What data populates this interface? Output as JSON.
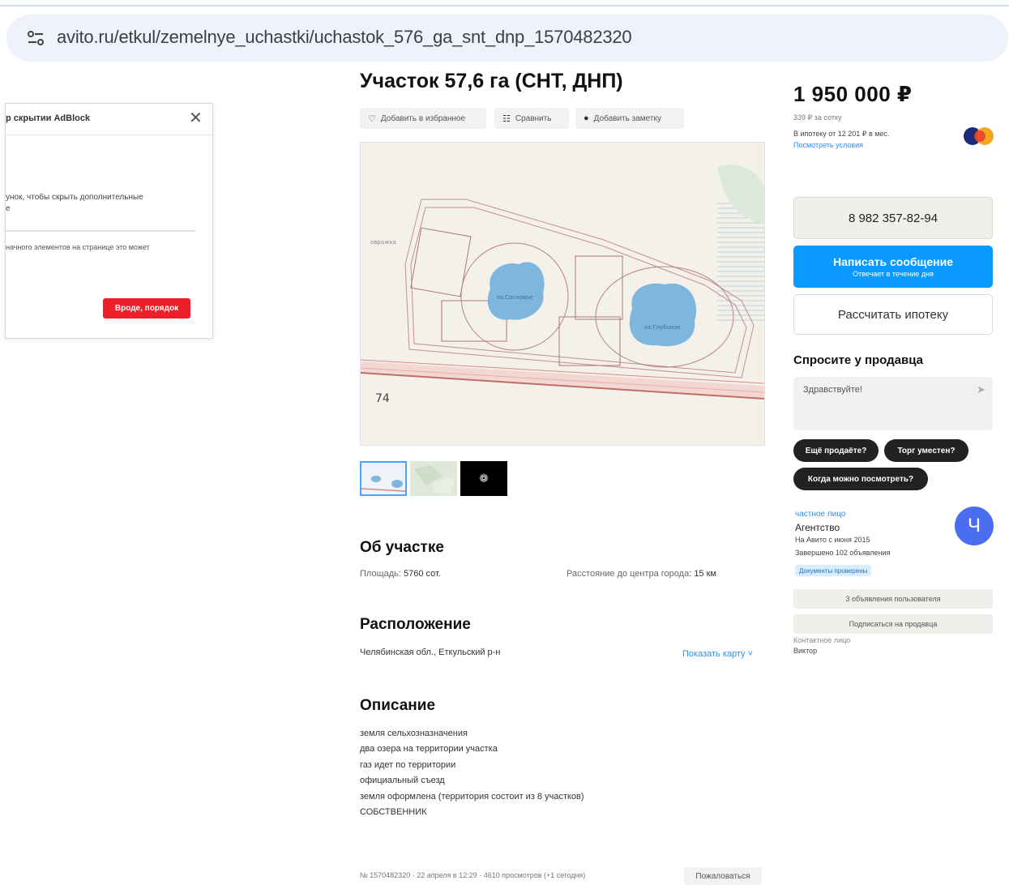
{
  "browser": {
    "url": "avito.ru/etkul/zemelnye_uchastki/uchastok_576_ga_snt_dnp_1570482320"
  },
  "adblock_popup": {
    "title": "р скрытии AdBlock",
    "text_line1": "унок, чтобы скрыть дополнительные",
    "text_line1_end": "е",
    "text_line2": "начного элементов на странице это может",
    "button_label": "Вроде, порядок"
  },
  "listing": {
    "title": "Участок 57,6 га (СНТ, ДНП)",
    "actions": {
      "favorite": "Добавить в избранное",
      "compare": "Сравнить",
      "note": "Добавить заметку"
    },
    "map_labels": {
      "lake1": "оз.Сосновое",
      "lake2": "оз.Глубокое",
      "road_number": "74",
      "village": "овражка"
    },
    "about": {
      "heading": "Об участке",
      "area_label": "Площадь:",
      "area_value": "5760 сот.",
      "distance_label": "Расстояние до центра города:",
      "distance_value": "15 км"
    },
    "location": {
      "heading": "Расположение",
      "address": "Челябинская обл., Еткульский р-н",
      "show_map": "Показать карту"
    },
    "description": {
      "heading": "Описание",
      "lines": [
        "земля сельхозназначения",
        "два озера на территории участка",
        "газ идет по территории",
        "официальный съезд",
        "земля оформлена (территория состоит из 8 участков)",
        "СОБСТВЕННИК"
      ]
    },
    "footer": {
      "meta": "№ 1570482320 · 22 апреля в 12:29 · 4610 просмотров (+1 сегодня)",
      "complain": "Пожаловаться"
    }
  },
  "sidebar": {
    "price": "1 950 000 ₽",
    "per_sotka": "339 ₽ за сотку",
    "mortgage": "В ипотеку от 12 201 ₽ в мес.",
    "mortgage_link": "Посмотреть условия",
    "phone": "8 982 357-82-94",
    "message": {
      "label": "Написать сообщение",
      "sub": "Отвечает в течение дня"
    },
    "calc_mortgage": "Рассчитать ипотеку",
    "ask": {
      "title": "Спросите у продавца",
      "placeholder": "Здравствуйте!",
      "chips": [
        "Ещё продаёте?",
        "Торг уместен?",
        "Когда можно посмотреть?"
      ]
    },
    "seller": {
      "type": "частное лицо",
      "name": "Агентство",
      "since": "На Авито с июня 2015",
      "completed": "Завершено 102 объявления",
      "verified": "Документы проверены",
      "avatar_letter": "Ч",
      "listings_button": "3 объявления пользователя",
      "subscribe_button": "Подписаться на продавца",
      "contact_label": "Контактное лицо",
      "contact_name": "Виктор"
    }
  },
  "colors": {
    "primary_blue": "#0a99ff",
    "link_blue": "#2a8ef5",
    "adblock_red": "#ef1f2a",
    "avatar": "#4b6df0"
  }
}
